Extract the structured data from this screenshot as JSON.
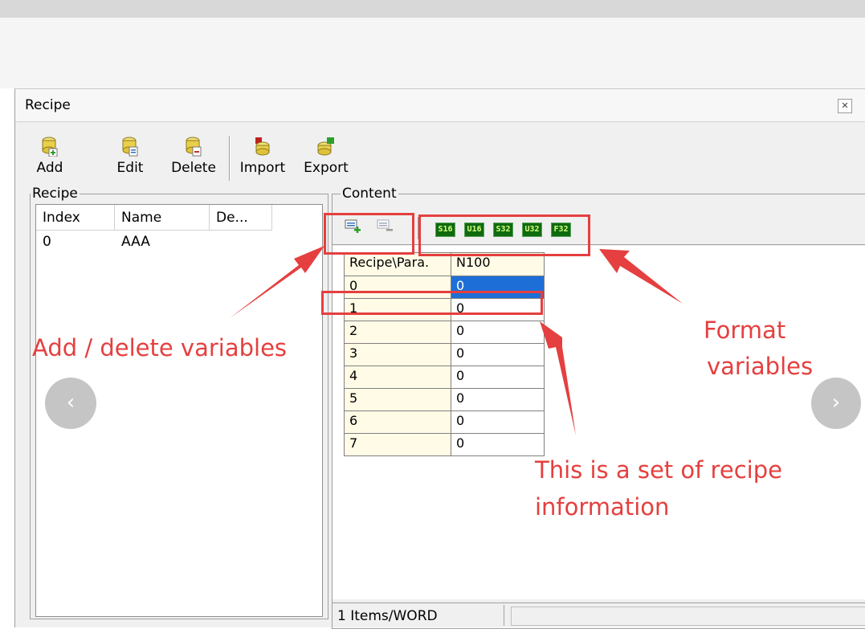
{
  "window": {
    "title": "Recipe",
    "close_glyph": "✕"
  },
  "toolbar": {
    "buttons": [
      {
        "label": "Add",
        "icon": "add-recipe-icon"
      },
      {
        "label": "Edit",
        "icon": "edit-recipe-icon"
      },
      {
        "label": "Delete",
        "icon": "delete-recipe-icon"
      },
      {
        "label": "Import",
        "icon": "import-recipe-icon"
      },
      {
        "label": "Export",
        "icon": "export-recipe-icon"
      }
    ]
  },
  "recipe_panel": {
    "label": "Recipe",
    "columns": [
      "Index",
      "Name",
      "De..."
    ],
    "rows": [
      {
        "index": "0",
        "name": "AAA"
      }
    ]
  },
  "content_panel": {
    "label": "Content",
    "format_buttons": [
      "S16",
      "U16",
      "S32",
      "U32",
      "F32"
    ],
    "grid": {
      "corner_header": "Recipe\\Para.",
      "column_header": "N100",
      "rows": [
        {
          "label": "0",
          "value": "0"
        },
        {
          "label": "1",
          "value": "0"
        },
        {
          "label": "2",
          "value": "0"
        },
        {
          "label": "3",
          "value": "0"
        },
        {
          "label": "4",
          "value": "0"
        },
        {
          "label": "5",
          "value": "0"
        },
        {
          "label": "6",
          "value": "0"
        },
        {
          "label": "7",
          "value": "0"
        }
      ]
    },
    "status": "1 Items/WORD"
  },
  "annotations": {
    "add_delete": "Add / delete variables",
    "format_line1": "Format",
    "format_line2": "variables",
    "recipe_line1": "This is a set of recipe",
    "recipe_line2": "information"
  },
  "colors": {
    "annotation": "#e53f3f",
    "selected_cell": "#1e6ed8",
    "format_button": "#0e6b0e"
  }
}
